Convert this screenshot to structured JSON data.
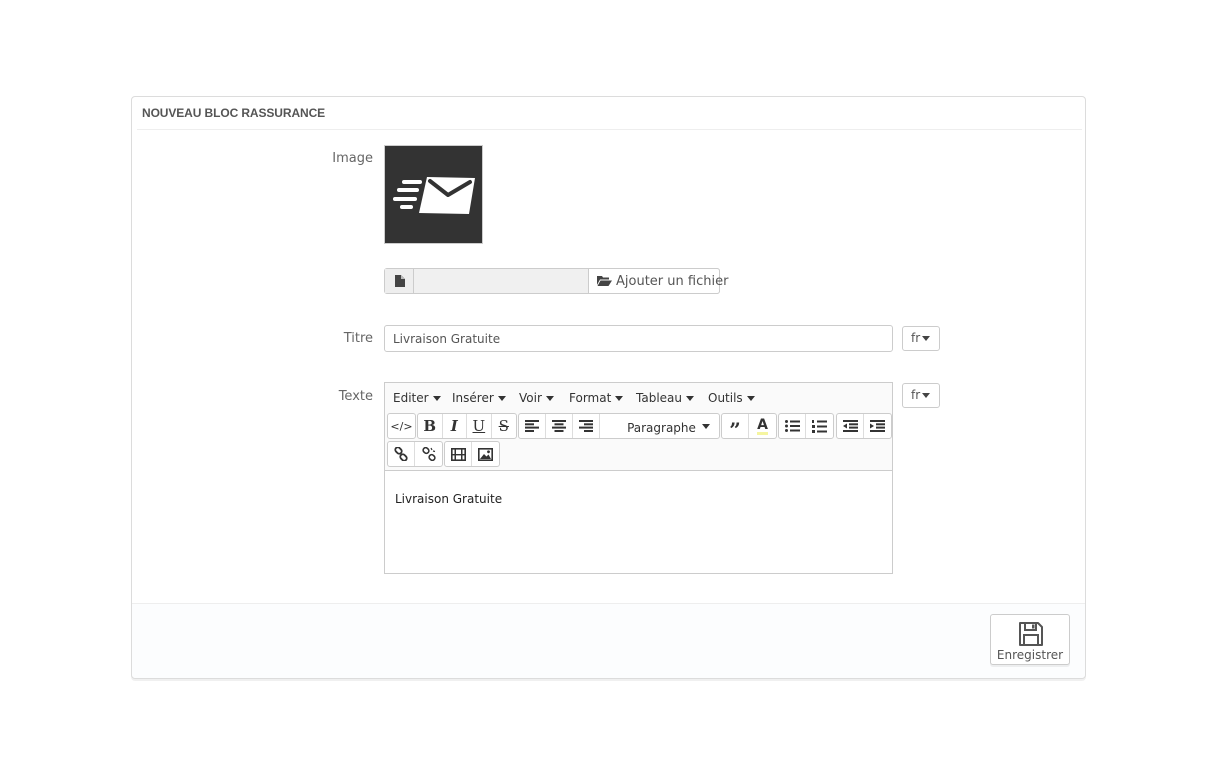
{
  "panel": {
    "title": "NOUVEAU BLOC RASSURANCE"
  },
  "form": {
    "image_label": "Image",
    "image_icon": "envelope-fast-icon",
    "file": {
      "file_name": "",
      "add_label": "Ajouter un fichier"
    },
    "title_label": "Titre",
    "title_value": "Livraison Gratuite",
    "title_lang": "fr",
    "text_label": "Texte",
    "text_lang": "fr"
  },
  "editor": {
    "menus": [
      "Editer",
      "Insérer",
      "Voir",
      "Format",
      "Tableau",
      "Outils"
    ],
    "block_format": "Paragraphe",
    "content": "Livraison Gratuite"
  },
  "footer": {
    "save_label": "Enregistrer"
  },
  "colors": {
    "thumb_bg": "#333333",
    "border": "#cccccc"
  }
}
